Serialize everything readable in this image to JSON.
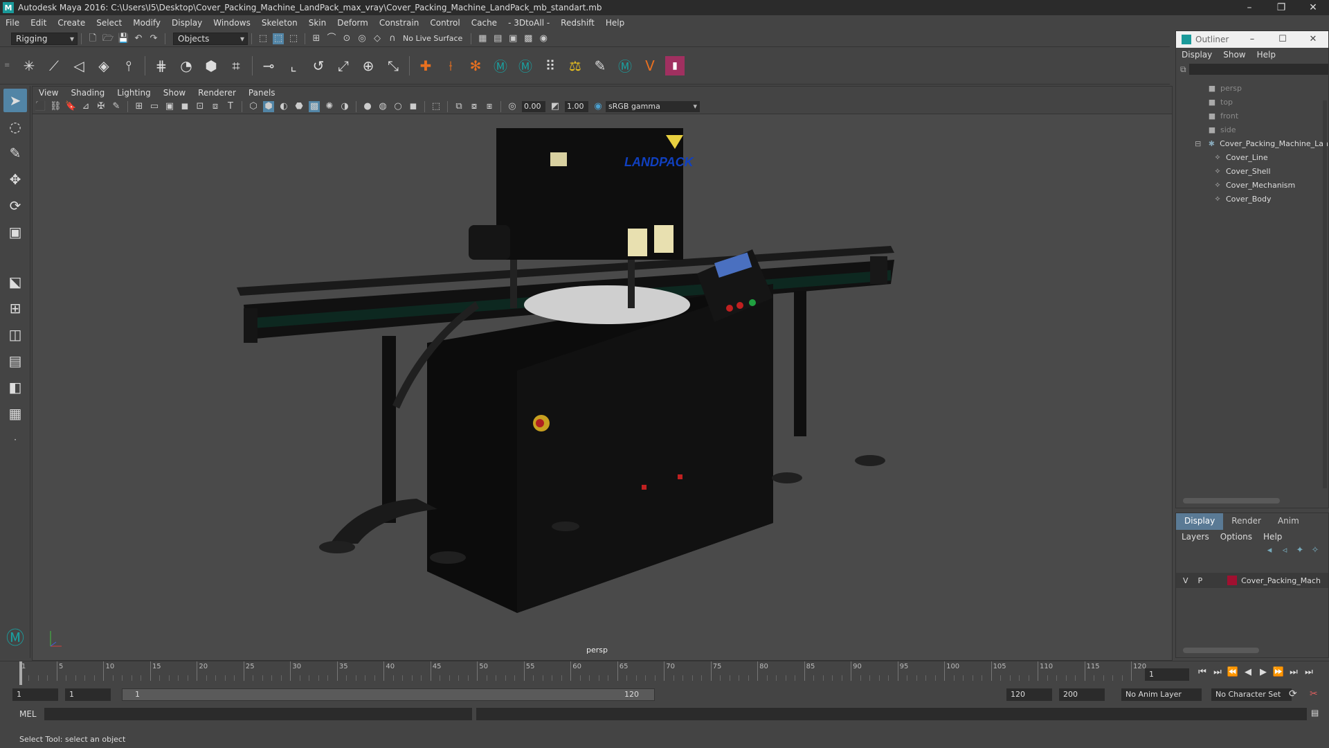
{
  "app": {
    "title": "Autodesk Maya 2016: C:\\Users\\I5\\Desktop\\Cover_Packing_Machine_LandPack_max_vray\\Cover_Packing_Machine_LandPack_mb_standart.mb",
    "logo": "M"
  },
  "menus": [
    "File",
    "Edit",
    "Create",
    "Select",
    "Modify",
    "Display",
    "Windows",
    "Skeleton",
    "Skin",
    "Deform",
    "Constrain",
    "Control",
    "Cache",
    "- 3DtoAll -",
    "Redshift",
    "Help"
  ],
  "status_line": {
    "mode": "Rigging",
    "objects_label": "Objects",
    "live_surface": "No Live Surface"
  },
  "viewport": {
    "menus": [
      "View",
      "Shading",
      "Lighting",
      "Show",
      "Renderer",
      "Panels"
    ],
    "exposure": "0.00",
    "gamma": "1.00",
    "color_space": "sRGB gamma",
    "camera_label": "persp",
    "scene_text": "LANDPACK"
  },
  "outliner": {
    "title": "Outliner",
    "menus": [
      "Display",
      "Show",
      "Help"
    ],
    "items": [
      {
        "label": "persp",
        "type": "camera",
        "indent": 0
      },
      {
        "label": "top",
        "type": "camera",
        "indent": 0
      },
      {
        "label": "front",
        "type": "camera",
        "indent": 0
      },
      {
        "label": "side",
        "type": "camera",
        "indent": 0
      },
      {
        "label": "Cover_Packing_Machine_Lan",
        "type": "group",
        "indent": 0
      },
      {
        "label": "Cover_Line",
        "type": "mesh",
        "indent": 1
      },
      {
        "label": "Cover_Shell",
        "type": "mesh",
        "indent": 1
      },
      {
        "label": "Cover_Mechanism",
        "type": "mesh",
        "indent": 1
      },
      {
        "label": "Cover_Body",
        "type": "mesh",
        "indent": 1
      }
    ]
  },
  "layers": {
    "tabs": [
      "Display",
      "Render",
      "Anim"
    ],
    "active_tab": "Display",
    "menus": [
      "Layers",
      "Options",
      "Help"
    ],
    "row": {
      "v": "V",
      "p": "P",
      "name": "Cover_Packing_Machir",
      "color": "#a01030"
    }
  },
  "timeline": {
    "ticks": [
      "1",
      "5",
      "10",
      "15",
      "20",
      "25",
      "30",
      "35",
      "40",
      "45",
      "50",
      "55",
      "60",
      "65",
      "70",
      "75",
      "80",
      "85",
      "90",
      "95",
      "100",
      "105",
      "110",
      "115",
      "120"
    ],
    "current_frame": "1"
  },
  "range": {
    "start": "1",
    "playback_start": "1",
    "slider_start": "1",
    "slider_end": "120",
    "playback_end": "120",
    "end": "200",
    "anim_layer": "No Anim Layer",
    "character_set": "No Character Set"
  },
  "command_line": {
    "label": "MEL"
  },
  "help_line": "Select Tool: select an object",
  "colors": {
    "accent": "#5285a6",
    "layer": "#a01030",
    "bg": "#444444"
  }
}
